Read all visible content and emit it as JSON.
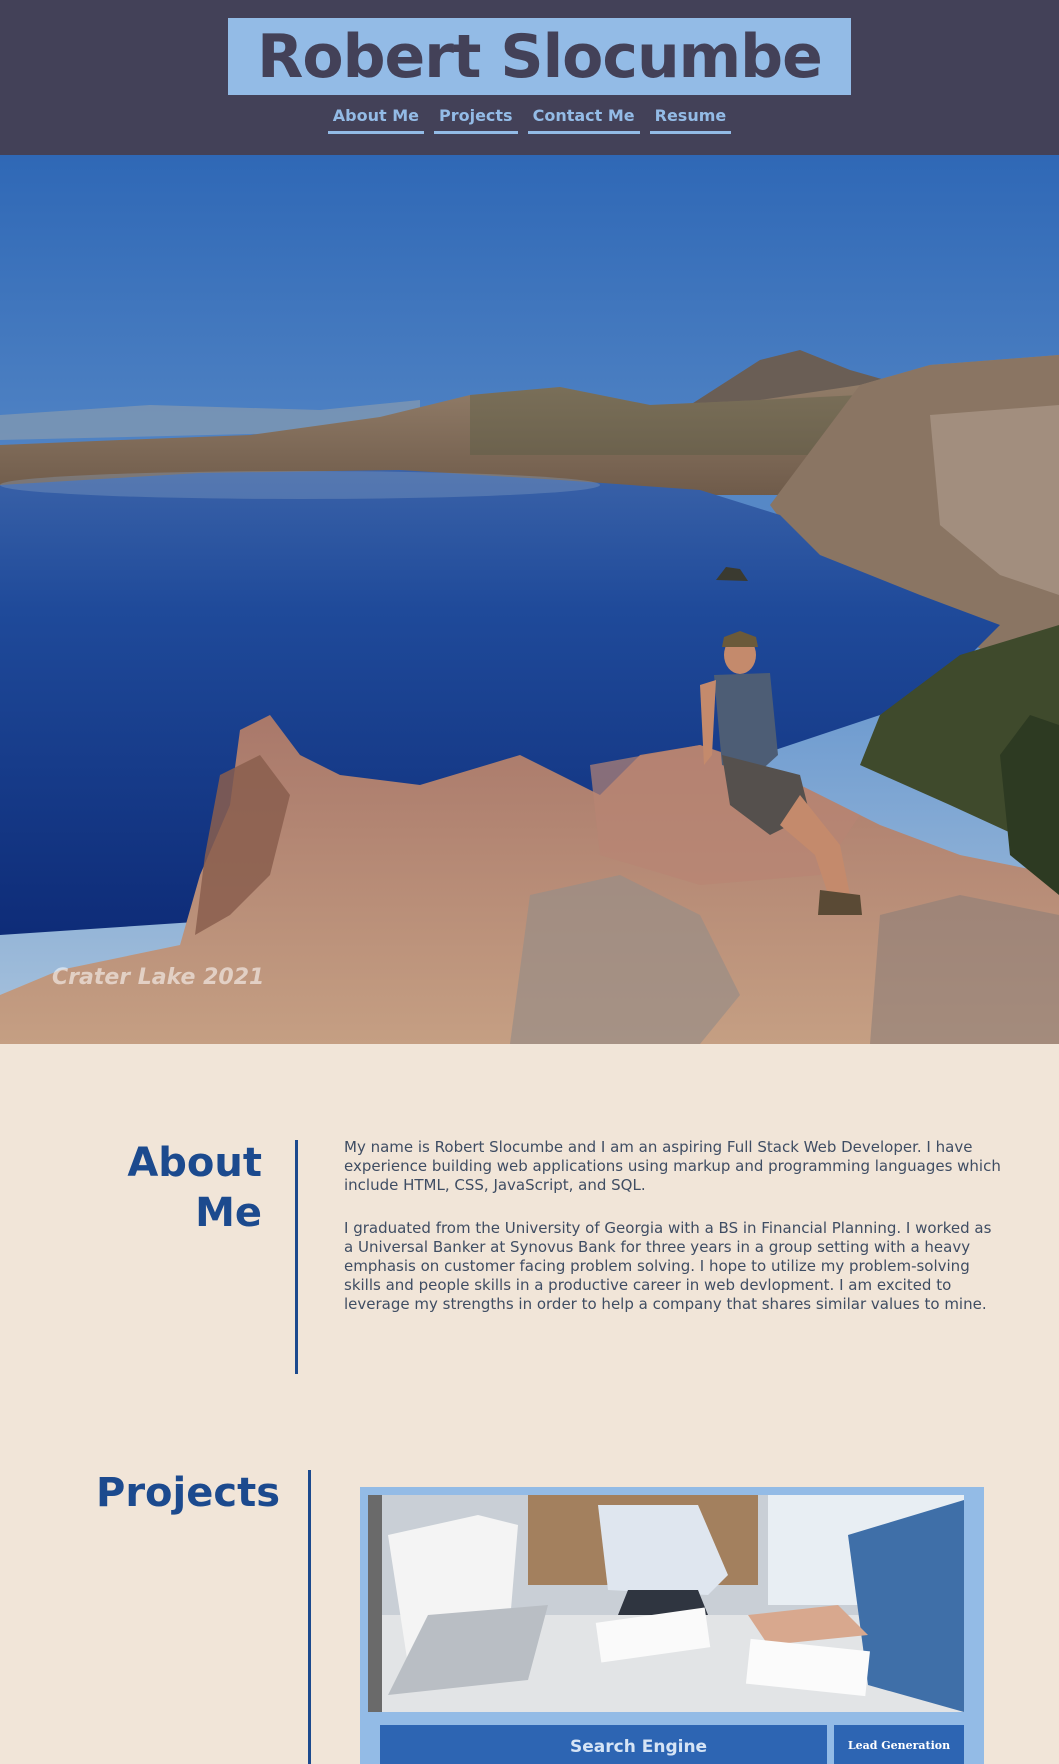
{
  "header": {
    "title": "Robert Slocumbe",
    "nav": [
      "About Me",
      "Projects",
      "Contact Me",
      "Resume"
    ]
  },
  "hero": {
    "caption": "Crater Lake 2021"
  },
  "about": {
    "title": "About Me",
    "paragraphs": [
      "My name is Robert Slocumbe and I am an aspiring Full Stack Web Developer. I have experience building web applications using markup and programming languages which include HTML, CSS, JavaScript, and SQL.",
      "I graduated from the University of Georgia with a BS in Financial Planning. I worked as a Universal Banker at Synovus Bank for three years in a group setting with a heavy emphasis on customer facing problem solving. I hope to utilize my problem-solving skills and people skills in a productive career in web devlopment. I am excited to leverage my strengths in order to help a company that shares similar values to mine."
    ]
  },
  "projects": {
    "title": "Projects",
    "card": {
      "bar_text": "Search Engine",
      "tag": "Lead Generation"
    }
  },
  "colors": {
    "header_bg": "#434158",
    "accent_light": "#93bbe6",
    "accent_dark": "#1c4a8e",
    "page_bg": "#f1e5d8"
  }
}
